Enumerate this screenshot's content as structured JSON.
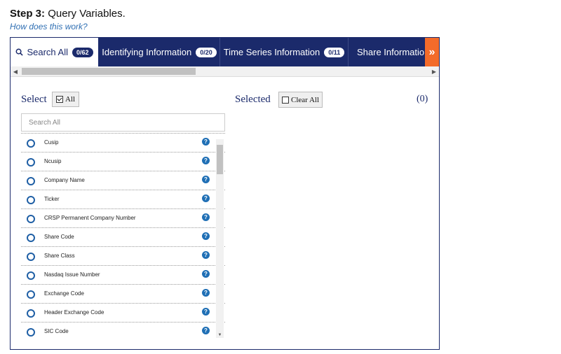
{
  "step": {
    "prefix": "Step 3:",
    "title": "Query Variables."
  },
  "help_link": "How does this work?",
  "tabs": [
    {
      "label": "Search All",
      "badge": "0/62",
      "active": true
    },
    {
      "label": "Identifying Information",
      "badge": "0/20"
    },
    {
      "label": "Time Series Information",
      "badge": "0/11"
    },
    {
      "label": "Share Information"
    }
  ],
  "select": {
    "label": "Select",
    "all_button": "All"
  },
  "selected": {
    "label": "Selected",
    "clear_button": "Clear All",
    "count": "(0)"
  },
  "search": {
    "placeholder": "Search All"
  },
  "items": [
    "Cusip",
    "Ncusip",
    "Company Name",
    "Ticker",
    "CRSP Permanent Company Number",
    "Share Code",
    "Share Class",
    "Nasdaq Issue Number",
    "Exchange Code",
    "Header Exchange Code",
    "SIC Code"
  ],
  "colors": {
    "navy": "#1b2a6b",
    "orange": "#f36b2a",
    "link": "#2f6fb3",
    "radio": "#1f5fa5"
  }
}
